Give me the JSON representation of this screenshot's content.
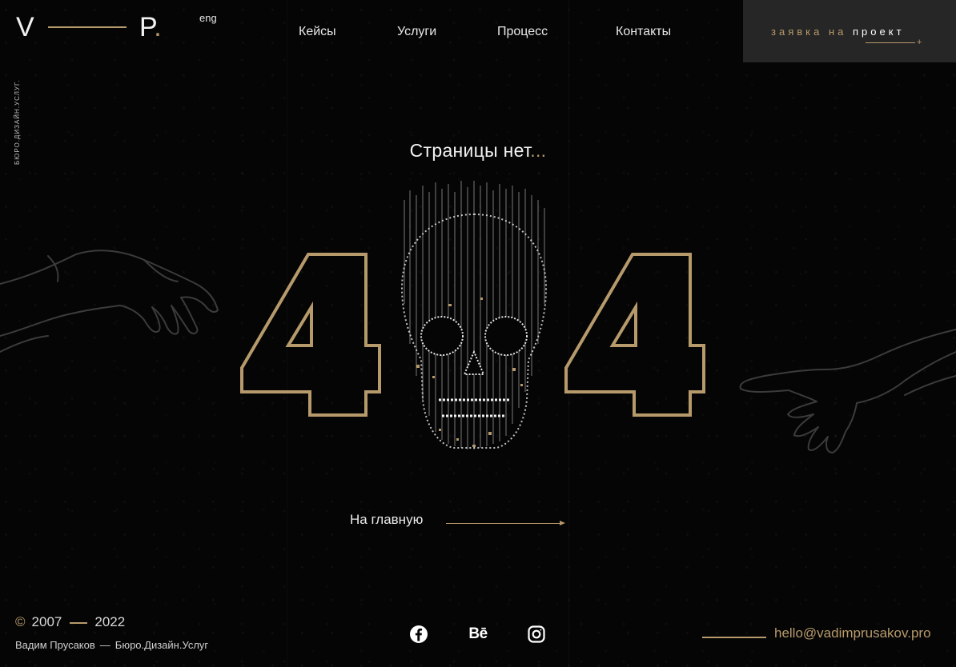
{
  "header": {
    "logo": {
      "letter_left": "V",
      "letter_right": "P",
      "dot": "."
    },
    "lang": "eng",
    "tagline": "БЮРО.ДИЗАЙН.УСЛУГ.",
    "nav": [
      {
        "label": "Кейсы"
      },
      {
        "label": "Услуги"
      },
      {
        "label": "Процесс"
      },
      {
        "label": "Контакты"
      }
    ],
    "cta": {
      "label_accent": "заявка на",
      "label_main": "проект",
      "plus": "+"
    }
  },
  "main": {
    "message": "Страницы нет",
    "message_dots": "...",
    "home_link": "На главную",
    "error_digits": [
      "4",
      "4"
    ],
    "skull_icon": "skull-icon"
  },
  "footer": {
    "copyright_symbol": "©",
    "year_start": "2007",
    "year_end": "2022",
    "author": "Вадим Прусаков",
    "separator": "—",
    "studio": "Бюро.Дизайн.Услуг",
    "social": [
      {
        "name": "facebook-icon"
      },
      {
        "name": "behance-icon",
        "glyph": "Bē"
      },
      {
        "name": "instagram-icon"
      }
    ],
    "email": "hello@vadimprusakov.pro"
  },
  "colors": {
    "accent": "#b79a6c",
    "background": "#050505",
    "cta_bg": "#262626",
    "text": "#ffffff"
  }
}
